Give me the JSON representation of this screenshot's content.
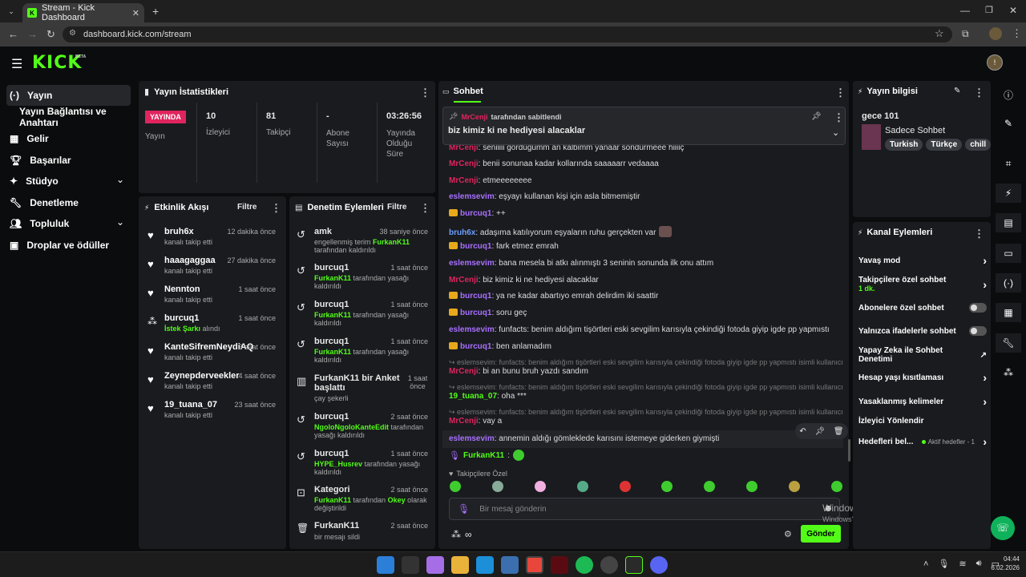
{
  "browser": {
    "tab_title": "Stream - Kick Dashboard",
    "url": "dashboard.kick.com/stream"
  },
  "app": {
    "logo": "KICK",
    "logo_badge": "BETA"
  },
  "sidebar": {
    "items": [
      {
        "label": "Yayın",
        "icon": "broadcast-icon"
      },
      {
        "label": "Yayın Bağlantısı ve Anahtarı",
        "icon": ""
      },
      {
        "label": "Gelir",
        "icon": "revenue-icon"
      },
      {
        "label": "Başarılar",
        "icon": "trophy-icon"
      },
      {
        "label": "Stüdyo",
        "icon": "studio-icon"
      },
      {
        "label": "Denetleme",
        "icon": "wrench-icon"
      },
      {
        "label": "Topluluk",
        "icon": "community-icon"
      },
      {
        "label": "Droplar ve ödüller",
        "icon": "drops-icon"
      }
    ]
  },
  "stats": {
    "title": "Yayın İstatistikleri",
    "live_badge": "YAYINDA",
    "live_label": "Yayın",
    "viewers_value": "10",
    "viewers_label": "İzleyici",
    "followers_value": "81",
    "followers_label": "Takipçi",
    "subs_value": "-",
    "subs_label": "Abone Sayısı",
    "duration_value": "03:26:56",
    "duration_label": "Yayında Olduğu Süre"
  },
  "activity": {
    "title": "Etkinlik Akışı",
    "filter": "Filtre",
    "items": [
      {
        "name": "bruh6x",
        "sub": "kanalı takip etti",
        "time": "12 dakika önce"
      },
      {
        "name": "haaagaggaa",
        "sub": "kanalı takip etti",
        "time": "27 dakika önce"
      },
      {
        "name": "Nennton",
        "sub": "kanalı takip etti",
        "time": "1 saat önce"
      },
      {
        "name": "burcuq1",
        "sub_green": "İstek Şarkı",
        "sub": " alındı",
        "time": "1 saat önce"
      },
      {
        "name": "KanteSifremNeydiAQ",
        "sub": "kanalı takip etti",
        "time": "3 saat önce"
      },
      {
        "name": "Zeynepderveekler",
        "sub": "kanalı takip etti",
        "time": "4 saat önce"
      },
      {
        "name": "19_tuana_07",
        "sub": "kanalı takip etti",
        "time": "23 saat önce"
      }
    ]
  },
  "moderation": {
    "title": "Denetim Eylemleri",
    "filter": "Filtre",
    "items": [
      {
        "name": "amk",
        "time": "38 saniye önce",
        "l1": "engellenmiş terim ",
        "g1": "FurkanK11",
        "l2": "tarafından kaldırıldı"
      },
      {
        "name": "burcuq1",
        "time": "1 saat önce",
        "g1": "FurkanK11",
        "l1": " tarafından yasağı",
        "l2": "kaldırıldı"
      },
      {
        "name": "burcuq1",
        "time": "1 saat önce",
        "g1": "FurkanK11",
        "l1": " tarafından yasağı",
        "l2": "kaldırıldı"
      },
      {
        "name": "burcuq1",
        "time": "1 saat önce",
        "g1": "FurkanK11",
        "l1": " tarafından yasağı",
        "l2": "kaldırıldı"
      },
      {
        "name": "FurkanK11 bir Anket başlattı",
        "time": "1 saat önce",
        "l2": "çay şekerli"
      },
      {
        "name": "burcuq1",
        "time": "2 saat önce",
        "g1": "NgoloNgoloKanteEdit",
        "l1": " tarafından",
        "l2": "yasağı kaldırıldı"
      },
      {
        "name": "burcuq1",
        "time": "1 saat önce",
        "g1": "HYPE_Husrev",
        "l1": " tarafından yasağı",
        "l2": "kaldırıldı"
      },
      {
        "name": "Kategori",
        "time": "2 saat önce",
        "g1": "FurkanK11",
        "l1": " tarafından ",
        "g2": "Okey",
        "l1b": " olarak",
        "l2": "değiştirildi"
      },
      {
        "name": "FurkanK11",
        "time": "2 saat önce",
        "l2": "bir mesajı sildi"
      }
    ]
  },
  "chat": {
    "title": "Sohbet",
    "pinned_by_user": "MrCenji",
    "pinned_by_text": " tarafından sabitlendi",
    "pinned_text": "biz kimiz ki ne hediyesi alacaklar",
    "input_placeholder": "Bir mesaj gönderin",
    "send_label": "Gönder",
    "followers_only": "Takipçilere Özel",
    "messages": {
      "m0": {
        "user": "MrCenji",
        "text": ": seniiiii gördüğümm an kalbimm yanaar söndürmeee hiiiiç"
      },
      "m1": {
        "user": "MrCenji",
        "text": ": benii sonunaa kadar kollarında saaaaarr vedaaaa"
      },
      "m2": {
        "user": "MrCenji",
        "text": ": etmeeeeeeee"
      },
      "m3": {
        "user": "eslemsevim",
        "text": ": eşyayı kullanan kişi için asla bitmemiştir"
      },
      "m4": {
        "user": "burcuq1",
        "text": ": ++"
      },
      "m5": {
        "user": "bruh6x",
        "text": ": adaşıma katılıyorum eşyaların ruhu gerçekten var"
      },
      "m6": {
        "user": "burcuq1",
        "text": ": fark etmez emrah"
      },
      "m7": {
        "user": "eslemsevim",
        "text": ": bana mesela bi atkı alınmıştı 3 seninin sonunda ilk onu attım"
      },
      "m8": {
        "user": "MrCenji",
        "text": ": biz kimiz ki ne hediyesi alacaklar"
      },
      "m9": {
        "user": "burcuq1",
        "text": ": ya ne kadar abartıyo emrah delirdim iki saattir"
      },
      "m10": {
        "user": "burcuq1",
        "text": ": soru geç"
      },
      "m11": {
        "user": "eslemsevim",
        "text": ": funfacts: benim aldığım tişörtleri eski sevgilim karısıyla çekindiği fotoda giyip igde pp yapmıstı"
      },
      "m12": {
        "user": "burcuq1",
        "text": ": ben anlamadım"
      },
      "r1": "eslemsevim: funfacts: benim aldığım tişörtleri eski sevgilim karısıyla çekindiği fotoda giyip igde pp yapmıstı isimli kullanıcıy...",
      "m13": {
        "user": "MrCenji",
        "text": ": bi an bunu bruh yazdı sandım"
      },
      "r2": "eslemsevim: funfacts: benim aldığım tişörtleri eski sevgilim karısıyla çekindiği fotoda giyip igde pp yapmıstı isimli kullanıcıy...",
      "m14": {
        "user": "19_tuana_07",
        "text": ": oha ***"
      },
      "r3": "eslemsevim: funfacts: benim aldığım tişörtleri eski sevgilim karısıyla çekindiği fotoda giyip igde pp yapmıstı isimli kullanıcıy...",
      "m15": {
        "user": "MrCenji",
        "text": ": vay a"
      },
      "m16": {
        "user": "eslemsevim",
        "text": ": annemin aldığı gömleklede karısını istemeye giderken giymişti"
      },
      "m17": {
        "user": "FurkanK11",
        "text": ":"
      }
    }
  },
  "stream_info": {
    "title": "Yayın bilgisi",
    "stream_title": "gece 101",
    "category": "Sadece Sohbet",
    "tags": [
      "Turkish",
      "Türkçe",
      "chill"
    ]
  },
  "channel_actions": {
    "title": "Kanal Eylemleri",
    "slow_mode": "Yavaş mod",
    "followers_chat": "Takipçilere özel sohbet",
    "followers_chat_value": "1 dk.",
    "subs_chat": "Abonelere özel sohbet",
    "emote_chat": "Yalnızca ifadelerle sohbet",
    "ai_mod": "Yapay Zeka ile Sohbet Denetimi",
    "age_restrict": "Hesap yaşı kısıtlaması",
    "banned_words": "Yasaklanmış kelimeler",
    "viewer_redirect": "İzleyici Yönlendir",
    "goals": "Hedefleri bel...",
    "goals_status": "Aktif hedefler - 1"
  },
  "windows": {
    "activate_title": "Windows'u Etkinleştir",
    "activate_sub": "Windows'u etkinleştirmek için Ayarlar'a gidin.",
    "time": "04:44",
    "date": "6.02.2026"
  },
  "colors": {
    "accent": "#53fc18",
    "panel": "#191b1f",
    "live": "#e0245e"
  }
}
